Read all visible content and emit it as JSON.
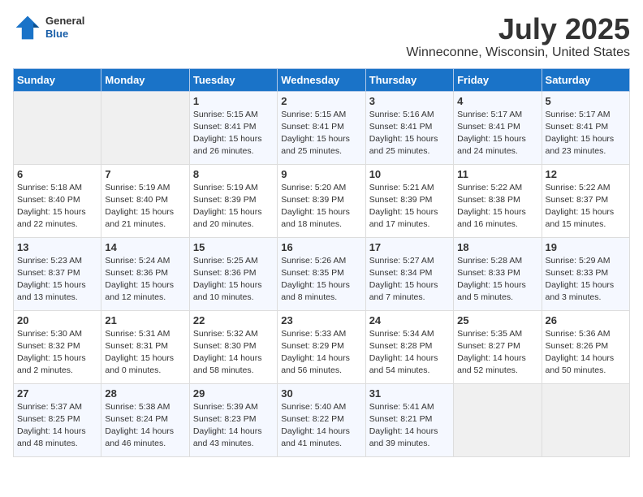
{
  "header": {
    "logo_general": "General",
    "logo_blue": "Blue",
    "month": "July 2025",
    "location": "Winneconne, Wisconsin, United States"
  },
  "weekdays": [
    "Sunday",
    "Monday",
    "Tuesday",
    "Wednesday",
    "Thursday",
    "Friday",
    "Saturday"
  ],
  "weeks": [
    [
      {
        "day": "",
        "info": ""
      },
      {
        "day": "",
        "info": ""
      },
      {
        "day": "1",
        "info": "Sunrise: 5:15 AM\nSunset: 8:41 PM\nDaylight: 15 hours\nand 26 minutes."
      },
      {
        "day": "2",
        "info": "Sunrise: 5:15 AM\nSunset: 8:41 PM\nDaylight: 15 hours\nand 25 minutes."
      },
      {
        "day": "3",
        "info": "Sunrise: 5:16 AM\nSunset: 8:41 PM\nDaylight: 15 hours\nand 25 minutes."
      },
      {
        "day": "4",
        "info": "Sunrise: 5:17 AM\nSunset: 8:41 PM\nDaylight: 15 hours\nand 24 minutes."
      },
      {
        "day": "5",
        "info": "Sunrise: 5:17 AM\nSunset: 8:41 PM\nDaylight: 15 hours\nand 23 minutes."
      }
    ],
    [
      {
        "day": "6",
        "info": "Sunrise: 5:18 AM\nSunset: 8:40 PM\nDaylight: 15 hours\nand 22 minutes."
      },
      {
        "day": "7",
        "info": "Sunrise: 5:19 AM\nSunset: 8:40 PM\nDaylight: 15 hours\nand 21 minutes."
      },
      {
        "day": "8",
        "info": "Sunrise: 5:19 AM\nSunset: 8:39 PM\nDaylight: 15 hours\nand 20 minutes."
      },
      {
        "day": "9",
        "info": "Sunrise: 5:20 AM\nSunset: 8:39 PM\nDaylight: 15 hours\nand 18 minutes."
      },
      {
        "day": "10",
        "info": "Sunrise: 5:21 AM\nSunset: 8:39 PM\nDaylight: 15 hours\nand 17 minutes."
      },
      {
        "day": "11",
        "info": "Sunrise: 5:22 AM\nSunset: 8:38 PM\nDaylight: 15 hours\nand 16 minutes."
      },
      {
        "day": "12",
        "info": "Sunrise: 5:22 AM\nSunset: 8:37 PM\nDaylight: 15 hours\nand 15 minutes."
      }
    ],
    [
      {
        "day": "13",
        "info": "Sunrise: 5:23 AM\nSunset: 8:37 PM\nDaylight: 15 hours\nand 13 minutes."
      },
      {
        "day": "14",
        "info": "Sunrise: 5:24 AM\nSunset: 8:36 PM\nDaylight: 15 hours\nand 12 minutes."
      },
      {
        "day": "15",
        "info": "Sunrise: 5:25 AM\nSunset: 8:36 PM\nDaylight: 15 hours\nand 10 minutes."
      },
      {
        "day": "16",
        "info": "Sunrise: 5:26 AM\nSunset: 8:35 PM\nDaylight: 15 hours\nand 8 minutes."
      },
      {
        "day": "17",
        "info": "Sunrise: 5:27 AM\nSunset: 8:34 PM\nDaylight: 15 hours\nand 7 minutes."
      },
      {
        "day": "18",
        "info": "Sunrise: 5:28 AM\nSunset: 8:33 PM\nDaylight: 15 hours\nand 5 minutes."
      },
      {
        "day": "19",
        "info": "Sunrise: 5:29 AM\nSunset: 8:33 PM\nDaylight: 15 hours\nand 3 minutes."
      }
    ],
    [
      {
        "day": "20",
        "info": "Sunrise: 5:30 AM\nSunset: 8:32 PM\nDaylight: 15 hours\nand 2 minutes."
      },
      {
        "day": "21",
        "info": "Sunrise: 5:31 AM\nSunset: 8:31 PM\nDaylight: 15 hours\nand 0 minutes."
      },
      {
        "day": "22",
        "info": "Sunrise: 5:32 AM\nSunset: 8:30 PM\nDaylight: 14 hours\nand 58 minutes."
      },
      {
        "day": "23",
        "info": "Sunrise: 5:33 AM\nSunset: 8:29 PM\nDaylight: 14 hours\nand 56 minutes."
      },
      {
        "day": "24",
        "info": "Sunrise: 5:34 AM\nSunset: 8:28 PM\nDaylight: 14 hours\nand 54 minutes."
      },
      {
        "day": "25",
        "info": "Sunrise: 5:35 AM\nSunset: 8:27 PM\nDaylight: 14 hours\nand 52 minutes."
      },
      {
        "day": "26",
        "info": "Sunrise: 5:36 AM\nSunset: 8:26 PM\nDaylight: 14 hours\nand 50 minutes."
      }
    ],
    [
      {
        "day": "27",
        "info": "Sunrise: 5:37 AM\nSunset: 8:25 PM\nDaylight: 14 hours\nand 48 minutes."
      },
      {
        "day": "28",
        "info": "Sunrise: 5:38 AM\nSunset: 8:24 PM\nDaylight: 14 hours\nand 46 minutes."
      },
      {
        "day": "29",
        "info": "Sunrise: 5:39 AM\nSunset: 8:23 PM\nDaylight: 14 hours\nand 43 minutes."
      },
      {
        "day": "30",
        "info": "Sunrise: 5:40 AM\nSunset: 8:22 PM\nDaylight: 14 hours\nand 41 minutes."
      },
      {
        "day": "31",
        "info": "Sunrise: 5:41 AM\nSunset: 8:21 PM\nDaylight: 14 hours\nand 39 minutes."
      },
      {
        "day": "",
        "info": ""
      },
      {
        "day": "",
        "info": ""
      }
    ]
  ]
}
